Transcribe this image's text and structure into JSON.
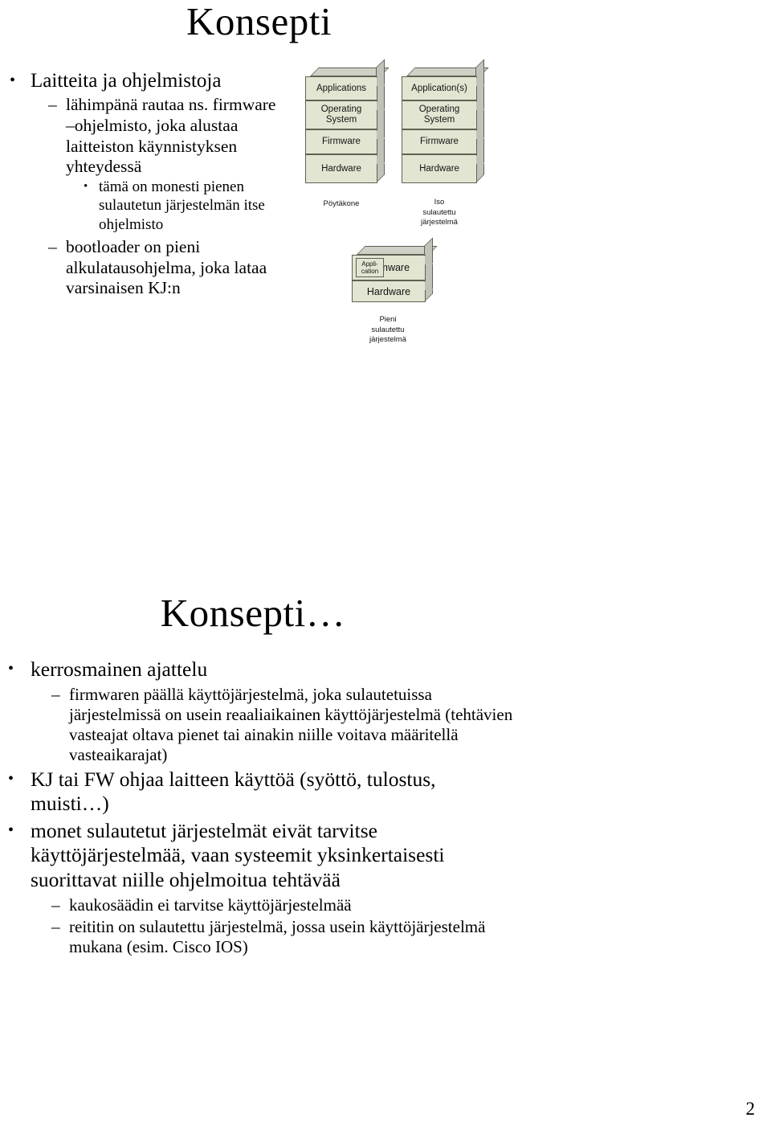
{
  "page": {
    "number": "2"
  },
  "slide1": {
    "title": "Konsepti",
    "bullets": [
      {
        "level": 1,
        "marker": "•",
        "text": "Laitteita ja ohjelmistoja"
      },
      {
        "level": 2,
        "marker": "–",
        "text": "lähimpänä rautaa ns. firmware –ohjelmisto, joka alustaa laitteiston käynnistyksen yhteydessä"
      },
      {
        "level": 3,
        "marker": "•",
        "text": "tämä on monesti pienen sulautetun järjestelmän itse ohjelmisto"
      },
      {
        "level": 2,
        "marker": "–",
        "text": "bootloader on pieni alkulatausohjelma, joka lataa varsinaisen KJ:n"
      }
    ]
  },
  "diagram": {
    "desktop_stack": {
      "caption": "Pöytäkone",
      "layers": [
        "Applications",
        "Operating System",
        "Firmware",
        "Hardware"
      ]
    },
    "large_embedded_stack": {
      "caption": "Iso\nsulautettu\njärjestelmä",
      "caption_lines": [
        "Iso",
        "sulautettu",
        "järjestelmä"
      ],
      "layers": [
        "Application(s)",
        "Operating System",
        "Firmware",
        "Hardware"
      ]
    },
    "small_embedded_stack": {
      "caption_lines": [
        "Pieni",
        "sulautettu",
        "järjestelmä"
      ],
      "layers": [
        "Firmware",
        "Hardware"
      ],
      "inset_box_lines": [
        "Appli-",
        "cation"
      ]
    },
    "colors": {
      "layer_fill": "#e2e5d1",
      "layer_stroke": "#5f6152",
      "side_face": "#c1c3ba",
      "top_face": "#cfd1c6"
    }
  },
  "slide2": {
    "title": "Konsepti…",
    "bullets": [
      {
        "level": 1,
        "marker": "•",
        "text": "kerrosmainen ajattelu"
      },
      {
        "level": 2,
        "marker": "–",
        "text": "firmwaren päällä käyttöjärjestelmä, joka sulautetuissa järjestelmissä on usein reaaliaikainen käyttöjärjestelmä (tehtävien vasteajat oltava pienet tai ainakin niille voitava määritellä vasteaikarajat)"
      },
      {
        "level": 1,
        "marker": "•",
        "text": "KJ tai FW ohjaa laitteen käyttöä (syöttö, tulostus, muisti…)"
      },
      {
        "level": 1,
        "marker": "•",
        "text": "monet sulautetut järjestelmät eivät tarvitse käyttöjärjestelmää, vaan systeemit yksinkertaisesti suorittavat niille ohjelmoitua tehtävää"
      },
      {
        "level": 2,
        "marker": "–",
        "text": "kaukosäädin ei tarvitse käyttöjärjestelmää"
      },
      {
        "level": 2,
        "marker": "–",
        "text": "reititin on sulautettu järjestelmä, jossa usein käyttöjärjestelmä mukana (esim. Cisco IOS)"
      }
    ]
  }
}
